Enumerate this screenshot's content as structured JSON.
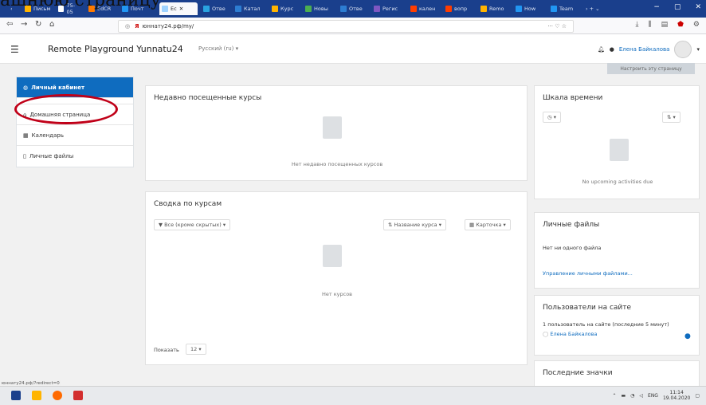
{
  "overlay_text": "ашнюю страницу",
  "browser": {
    "tabs": [
      {
        "label": "Письм",
        "color": "#ffb400"
      },
      {
        "label": "75-05",
        "color": "#ffffff"
      },
      {
        "label": "EdCR",
        "color": "#ff7a00"
      },
      {
        "label": "Почт",
        "color": "#2196f3"
      },
      {
        "label": "Ec",
        "color": "#9fd3ff"
      },
      {
        "label": "Отве",
        "color": "#29a3e0"
      },
      {
        "label": "Катал",
        "color": "#2d7dd2"
      },
      {
        "label": "Курс",
        "color": "#ffb400"
      },
      {
        "label": "Новы",
        "color": "#4caf50"
      },
      {
        "label": "Отве",
        "color": "#2d7dd2"
      },
      {
        "label": "Регис",
        "color": "#7e57c2"
      },
      {
        "label": "кален",
        "color": "#ff3d00"
      },
      {
        "label": "вопр",
        "color": "#ff3d00"
      },
      {
        "label": "Remo",
        "color": "#ffb400"
      },
      {
        "label": "How",
        "color": "#2196f3"
      },
      {
        "label": "Team",
        "color": "#2196f3"
      }
    ],
    "url": "юннату24.рф/my/",
    "url_actions": "··· ♡ ☆",
    "status_url": "юннату24.рф/?redirect=0"
  },
  "header": {
    "site_name": "Remote Playground Yunnatu24",
    "language": "Русский (ru) ▾",
    "user_name": "Елена Байкалова",
    "customize_button": "Настроить эту страницу"
  },
  "nav": {
    "items": [
      {
        "label": "Личный кабинет",
        "icon": "dashboard-icon"
      },
      {
        "label": "Домашняя страница",
        "icon": "home-icon"
      },
      {
        "label": "Календарь",
        "icon": "calendar-icon"
      },
      {
        "label": "Личные файлы",
        "icon": "file-icon"
      }
    ]
  },
  "recent": {
    "title": "Недавно посещенные курсы",
    "empty": "Нет недавно посещенных курсов"
  },
  "overview": {
    "title": "Сводка по курсам",
    "filter": "Все (кроме скрытых)",
    "sort": "Название курса",
    "view": "Карточка",
    "empty": "Нет курсов",
    "show_label": "Показать",
    "show_value": "12"
  },
  "timeline": {
    "title": "Шкала времени",
    "empty": "No upcoming activities due"
  },
  "files": {
    "title": "Личные файлы",
    "empty": "Нет ни одного файла",
    "manage_link": "Управление личными файлами..."
  },
  "online": {
    "title": "Пользователи на сайте",
    "summary": "1 пользователь на сайте (последние 5 минут)",
    "user": "Елена Байкалова"
  },
  "badges": {
    "title": "Последние значки"
  },
  "system": {
    "lang": "ENG",
    "time": "11:14",
    "date": "19.04.2020"
  }
}
